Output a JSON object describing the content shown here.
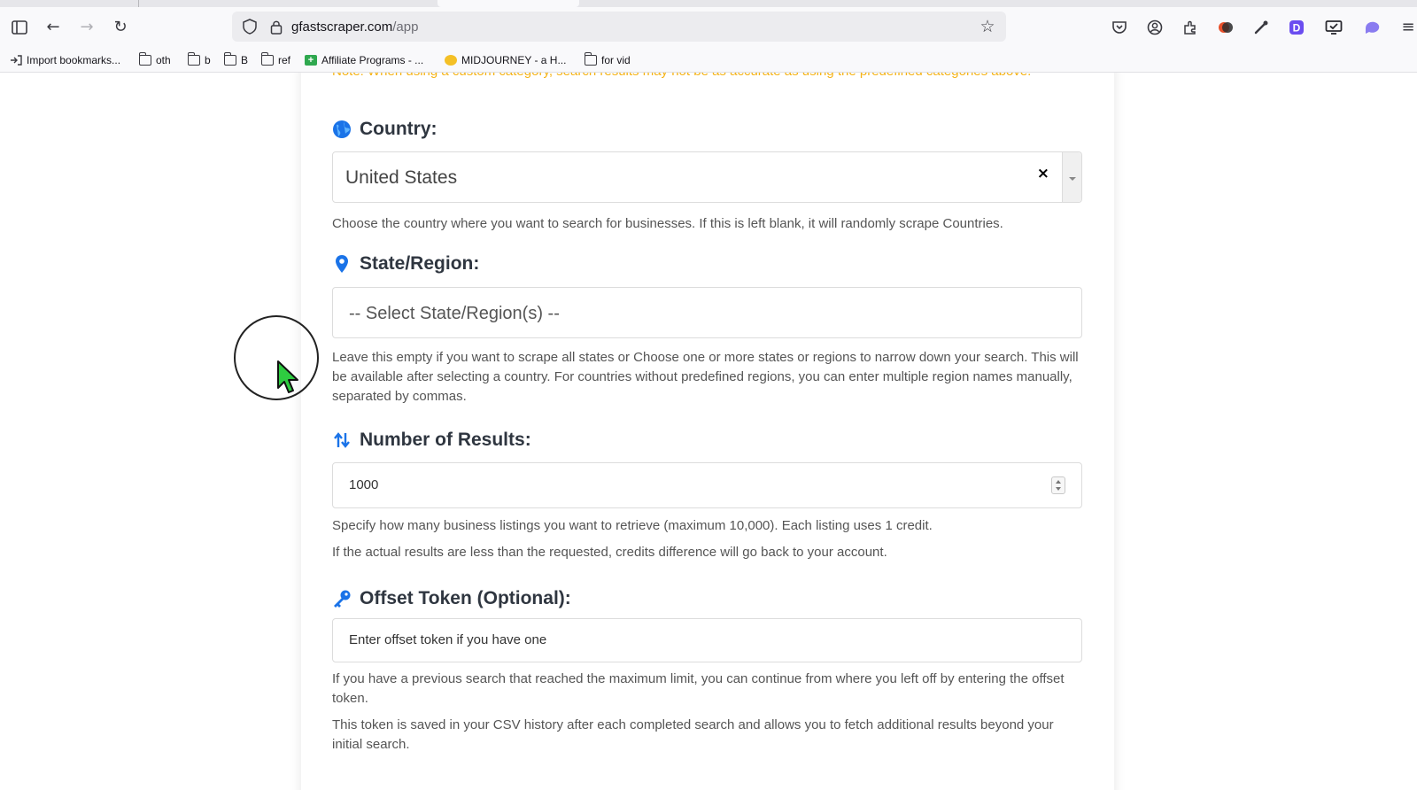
{
  "browser": {
    "url_host": "gfastscraper.com",
    "url_path": "/app",
    "bookmarks": [
      {
        "label": "Import bookmarks...",
        "icon": "import-icon"
      },
      {
        "label": "oth",
        "icon": "folder-icon"
      },
      {
        "label": "b",
        "icon": "folder-icon"
      },
      {
        "label": "B",
        "icon": "folder-icon"
      },
      {
        "label": "ref",
        "icon": "folder-icon"
      },
      {
        "label": "Affiliate Programs - ...",
        "icon": "green-plus-icon"
      },
      {
        "label": "MIDJOURNEY - a H...",
        "icon": "midjourney-icon"
      },
      {
        "label": "for vid",
        "icon": "folder-icon"
      }
    ]
  },
  "form": {
    "note": "Note: When using a custom category, search results may not be as accurate as using the predefined categories above.",
    "country": {
      "label": "Country:",
      "value": "United States",
      "clear": "×",
      "help": "Choose the country where you want to search for businesses. If this is left blank, it will randomly scrape Countries."
    },
    "state": {
      "label": "State/Region:",
      "placeholder": "-- Select State/Region(s) --",
      "help": "Leave this empty if you want to scrape all states or Choose one or more states or regions to narrow down your search. This will be available after selecting a country. For countries without predefined regions, you can enter multiple region names manually, separated by commas."
    },
    "results": {
      "label": "Number of Results:",
      "value": "1000",
      "help1": "Specify how many business listings you want to retrieve (maximum 10,000). Each listing uses 1 credit.",
      "help2": "If the actual results are less than the requested, credits difference will go back to your account."
    },
    "offset": {
      "label": "Offset Token (Optional):",
      "placeholder": "Enter offset token if you have one",
      "help1": "If you have a previous search that reached the maximum limit, you can continue from where you left off by entering the offset token.",
      "help2": "This token is saved in your CSV history after each completed search and allows you to fetch additional results beyond your initial search."
    }
  },
  "colors": {
    "note": "#f5b316",
    "accent_blue": "#1a73e8",
    "cursor_green": "#2ecc40"
  }
}
